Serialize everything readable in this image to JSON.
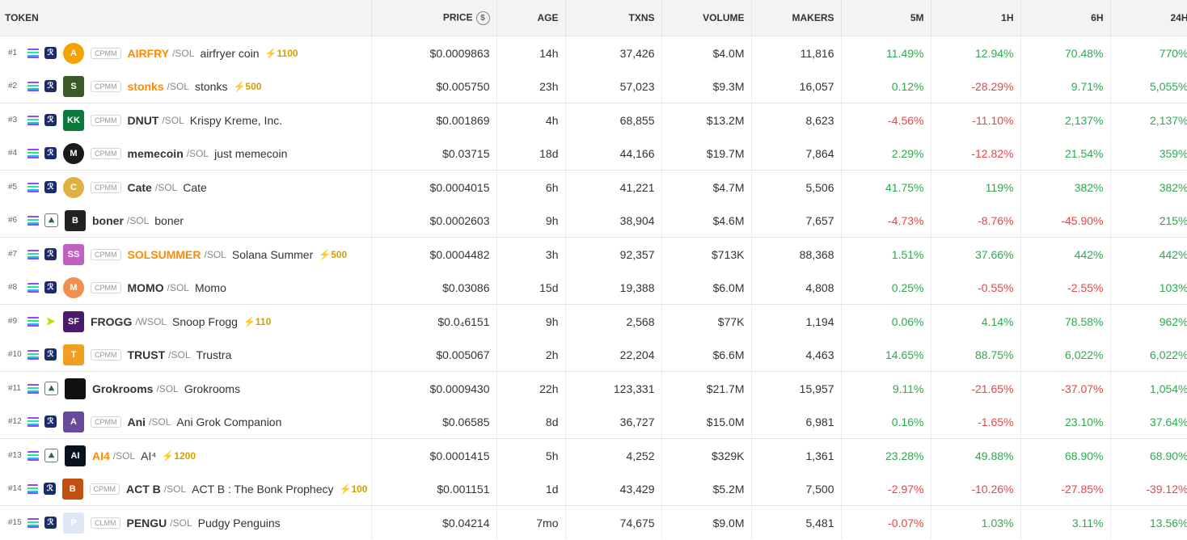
{
  "header": {
    "token": "TOKEN",
    "price": "PRICE",
    "age": "AGE",
    "txns": "TXNS",
    "volume": "VOLUME",
    "makers": "MAKERS",
    "m5": "5M",
    "h1": "1H",
    "h6": "6H",
    "h24": "24H"
  },
  "rows": [
    {
      "rank": "#1",
      "pool": "CPMM",
      "symbol": "AIRFRY",
      "quote": "/SOL",
      "name": "airfryer coin",
      "boost": "⚡1100",
      "price": "$0.0009863",
      "age": "14h",
      "txns": "37,426",
      "volume": "$4.0M",
      "makers": "11,816",
      "m5": "11.49%",
      "h1": "12.94%",
      "h6": "70.48%",
      "h24": "770%"
    },
    {
      "rank": "#2",
      "pool": "CPMM",
      "symbol": "stonks",
      "quote": "/SOL",
      "name": "stonks",
      "boost": "⚡500",
      "price": "$0.005750",
      "age": "23h",
      "txns": "57,023",
      "volume": "$9.3M",
      "makers": "16,057",
      "m5": "0.12%",
      "h1": "-28.29%",
      "h6": "9.71%",
      "h24": "5,055%"
    },
    {
      "rank": "#3",
      "pool": "CPMM",
      "symbol": "DNUT",
      "quote": "/SOL",
      "name": "Krispy Kreme, Inc.",
      "boost": "",
      "price": "$0.001869",
      "age": "4h",
      "txns": "68,855",
      "volume": "$13.2M",
      "makers": "8,623",
      "m5": "-4.56%",
      "h1": "-11.10%",
      "h6": "2,137%",
      "h24": "2,137%"
    },
    {
      "rank": "#4",
      "pool": "CPMM",
      "symbol": "memecoin",
      "quote": "/SOL",
      "name": "just memecoin",
      "boost": "",
      "price": "$0.03715",
      "age": "18d",
      "txns": "44,166",
      "volume": "$19.7M",
      "makers": "7,864",
      "m5": "2.29%",
      "h1": "-12.82%",
      "h6": "21.54%",
      "h24": "359%"
    },
    {
      "rank": "#5",
      "pool": "CPMM",
      "symbol": "Cate",
      "quote": "/SOL",
      "name": "Cate",
      "boost": "",
      "price": "$0.0004015",
      "age": "6h",
      "txns": "41,221",
      "volume": "$4.7M",
      "makers": "5,506",
      "m5": "41.75%",
      "h1": "119%",
      "h6": "382%",
      "h24": "382%"
    },
    {
      "rank": "#6",
      "pool": "",
      "symbol": "boner",
      "quote": "/SOL",
      "name": "boner",
      "boost": "",
      "price": "$0.0002603",
      "age": "9h",
      "txns": "38,904",
      "volume": "$4.6M",
      "makers": "7,657",
      "m5": "-4.73%",
      "h1": "-8.76%",
      "h6": "-45.90%",
      "h24": "215%"
    },
    {
      "rank": "#7",
      "pool": "CPMM",
      "symbol": "SOLSUMMER",
      "quote": "/SOL",
      "name": "Solana Summer",
      "boost": "⚡500",
      "price": "$0.0004482",
      "age": "3h",
      "txns": "92,357",
      "volume": "$713K",
      "makers": "88,368",
      "m5": "1.51%",
      "h1": "37.66%",
      "h6": "442%",
      "h24": "442%"
    },
    {
      "rank": "#8",
      "pool": "CPMM",
      "symbol": "MOMO",
      "quote": "/SOL",
      "name": "Momo",
      "boost": "",
      "price": "$0.03086",
      "age": "15d",
      "txns": "19,388",
      "volume": "$6.0M",
      "makers": "4,808",
      "m5": "0.25%",
      "h1": "-0.55%",
      "h6": "-2.55%",
      "h24": "103%"
    },
    {
      "rank": "#9",
      "pool": "",
      "symbol": "FROGG",
      "quote": "/WSOL",
      "name": "Snoop Frogg",
      "boost": "⚡110",
      "price": "$0.0₄6151",
      "age": "9h",
      "txns": "2,568",
      "volume": "$77K",
      "makers": "1,194",
      "m5": "0.06%",
      "h1": "4.14%",
      "h6": "78.58%",
      "h24": "962%"
    },
    {
      "rank": "#10",
      "pool": "CPMM",
      "symbol": "TRUST",
      "quote": "/SOL",
      "name": "Trustra",
      "boost": "",
      "price": "$0.005067",
      "age": "2h",
      "txns": "22,204",
      "volume": "$6.6M",
      "makers": "4,463",
      "m5": "14.65%",
      "h1": "88.75%",
      "h6": "6,022%",
      "h24": "6,022%"
    },
    {
      "rank": "#11",
      "pool": "",
      "symbol": "Grokrooms",
      "quote": "/SOL",
      "name": "Grokrooms",
      "boost": "",
      "price": "$0.0009430",
      "age": "22h",
      "txns": "123,331",
      "volume": "$21.7M",
      "makers": "15,957",
      "m5": "9.11%",
      "h1": "-21.65%",
      "h6": "-37.07%",
      "h24": "1,054%"
    },
    {
      "rank": "#12",
      "pool": "CPMM",
      "symbol": "Ani",
      "quote": "/SOL",
      "name": "Ani Grok Companion",
      "boost": "",
      "price": "$0.06585",
      "age": "8d",
      "txns": "36,727",
      "volume": "$15.0M",
      "makers": "6,981",
      "m5": "0.16%",
      "h1": "-1.65%",
      "h6": "23.10%",
      "h24": "37.64%"
    },
    {
      "rank": "#13",
      "pool": "",
      "symbol": "AI4",
      "quote": "/SOL",
      "name": "AI⁴",
      "boost": "⚡1200",
      "price": "$0.0001415",
      "age": "5h",
      "txns": "4,252",
      "volume": "$329K",
      "makers": "1,361",
      "m5": "23.28%",
      "h1": "49.88%",
      "h6": "68.90%",
      "h24": "68.90%"
    },
    {
      "rank": "#14",
      "pool": "CPMM",
      "symbol": "ACT B",
      "quote": "/SOL",
      "name": "ACT B : The Bonk Prophecy",
      "boost": "⚡100",
      "price": "$0.001151",
      "age": "1d",
      "txns": "43,429",
      "volume": "$5.2M",
      "makers": "7,500",
      "m5": "-2.97%",
      "h1": "-10.26%",
      "h6": "-27.85%",
      "h24": "-39.12%"
    },
    {
      "rank": "#15",
      "pool": "CLMM",
      "symbol": "PENGU",
      "quote": "/SOL",
      "name": "Pudgy Penguins",
      "boost": "",
      "price": "$0.04214",
      "age": "7mo",
      "txns": "74,675",
      "volume": "$9.0M",
      "makers": "5,481",
      "m5": "-0.07%",
      "h1": "1.03%",
      "h6": "3.11%",
      "h24": "13.56%"
    }
  ],
  "colors": {
    "positive": "#2fa84f",
    "negative": "#e64545",
    "boost": "#d69e00",
    "highlight_symbol": "#ff8a00"
  }
}
